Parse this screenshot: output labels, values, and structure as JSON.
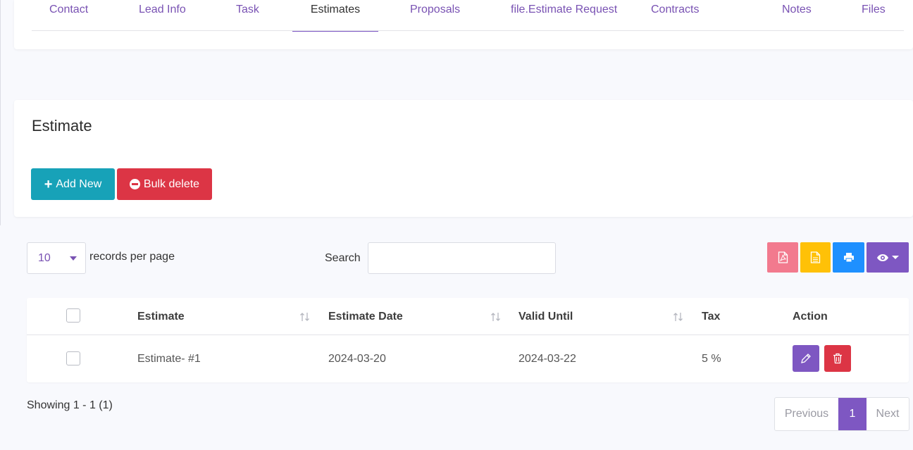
{
  "tabs": [
    {
      "label": "Contact",
      "active": false
    },
    {
      "label": "Lead Info",
      "active": false
    },
    {
      "label": "Task",
      "active": false
    },
    {
      "label": "Estimates",
      "active": true
    },
    {
      "label": "Proposals",
      "active": false
    },
    {
      "label": "file.Estimate Request",
      "active": false
    },
    {
      "label": "Contracts",
      "active": false
    },
    {
      "label": "Notes",
      "active": false
    },
    {
      "label": "Files",
      "active": false
    }
  ],
  "estimate_section": {
    "title": "Estimate",
    "add_new_label": "Add New",
    "bulk_delete_label": "Bulk delete"
  },
  "controls": {
    "per_page_value": "10",
    "per_page_label": "records per page",
    "search_label": "Search",
    "search_value": "",
    "export_buttons": [
      "pdf-icon",
      "document-icon",
      "print-icon",
      "eye-icon"
    ]
  },
  "table": {
    "columns": [
      "Estimate",
      "Estimate Date",
      "Valid Until",
      "Tax",
      "Action"
    ],
    "rows": [
      {
        "estimate": "Estimate- #1",
        "estimate_date": "2024-03-20",
        "valid_until": "2024-03-22",
        "tax": "5 %"
      }
    ]
  },
  "footer": {
    "showing": "Showing 1 - 1 (1)",
    "previous": "Previous",
    "current_page": "1",
    "next": "Next"
  },
  "colors": {
    "accent": "#7e57c2",
    "add_button": "#17a2b8",
    "danger": "#dc3545",
    "pdf": "#f27a8e",
    "doc": "#ffc107",
    "print": "#1e90ff"
  }
}
